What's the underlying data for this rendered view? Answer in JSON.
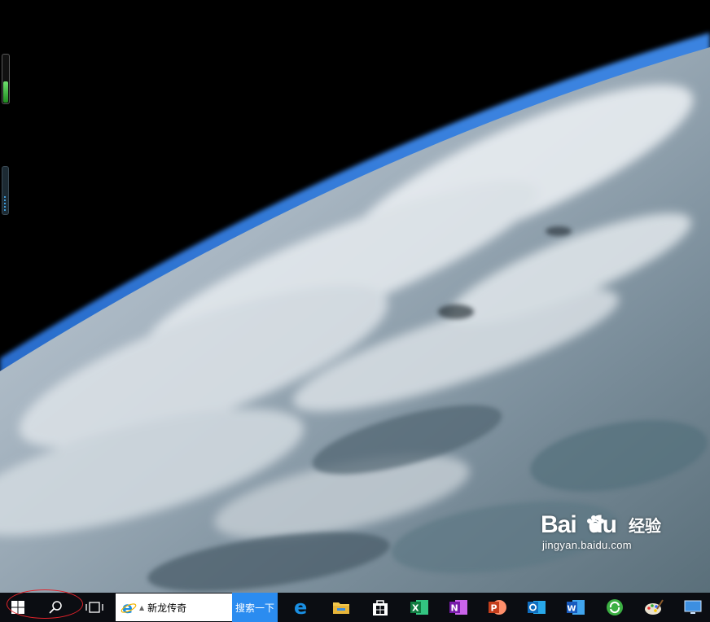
{
  "desktop": {
    "wallpaper_icon": "earth-from-orbit-wallpaper",
    "gadgets": [
      {
        "name": "cpu-meter-gadget",
        "level": 0.45
      },
      {
        "name": "network-meter-gadget",
        "level": 0.35
      }
    ],
    "watermark": {
      "logo": "Bai  du",
      "jingyan": "经验",
      "url": "jingyan.baidu.com"
    }
  },
  "taskbar": {
    "start_icon": "windows-start-icon",
    "search_icon": "search-icon",
    "task_view_icon": "task-view-icon",
    "address_bar": {
      "text": "新龙传奇",
      "icon": "ie-icon"
    },
    "search_button_label": "搜索一下",
    "pinned_apps": [
      {
        "name": "edge",
        "icon": "edge-icon"
      },
      {
        "name": "file-explorer",
        "icon": "folder-icon"
      },
      {
        "name": "store",
        "icon": "store-icon"
      },
      {
        "name": "excel",
        "icon": "excel-icon"
      },
      {
        "name": "onenote",
        "icon": "onenote-icon"
      },
      {
        "name": "powerpoint",
        "icon": "powerpoint-icon"
      },
      {
        "name": "outlook",
        "icon": "outlook-icon"
      },
      {
        "name": "word",
        "icon": "word-icon"
      },
      {
        "name": "360-browser",
        "icon": "green-circle-icon"
      },
      {
        "name": "paint",
        "icon": "paint-icon"
      },
      {
        "name": "computer",
        "icon": "computer-icon"
      }
    ]
  },
  "colors": {
    "accent": "#2b8cf0",
    "annotation_red": "#e3222a",
    "taskbar_bg": "#0b0d12"
  }
}
